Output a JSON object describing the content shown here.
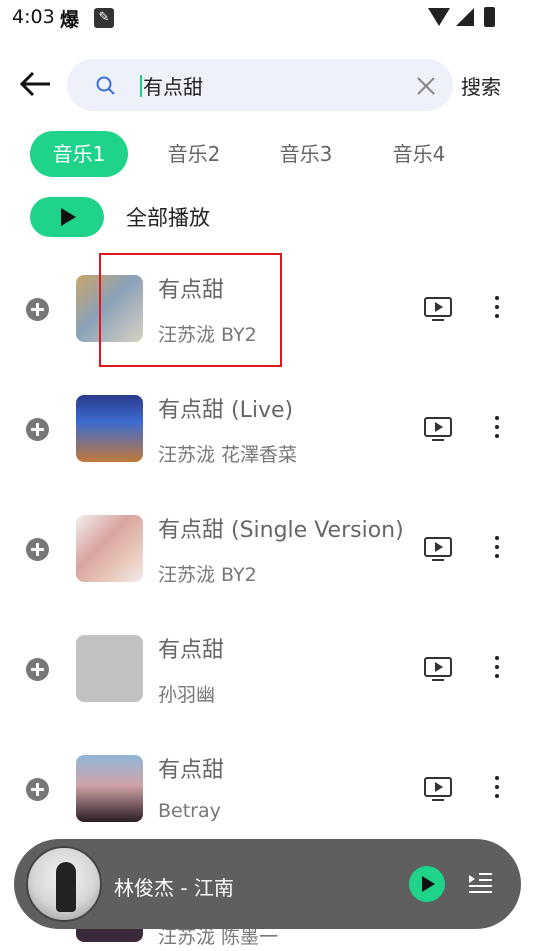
{
  "status_bar": {
    "time": "4:03",
    "extra": "爆"
  },
  "search": {
    "query": "有点甜",
    "submit_label": "搜索"
  },
  "tabs": [
    {
      "label": "音乐1",
      "active": true
    },
    {
      "label": "音乐2",
      "active": false
    },
    {
      "label": "音乐3",
      "active": false
    },
    {
      "label": "音乐4",
      "active": false
    }
  ],
  "play_all": {
    "label": "全部播放"
  },
  "songs": [
    {
      "title": "有点甜",
      "artist": "汪苏泷 BY2"
    },
    {
      "title": "有点甜 (Live)",
      "artist": "汪苏泷 花澤香菜"
    },
    {
      "title": "有点甜 (Single Version)",
      "artist": "汪苏泷 BY2"
    },
    {
      "title": "有点甜",
      "artist": "孙羽幽"
    },
    {
      "title": "有点甜",
      "artist": "Betray"
    },
    {
      "title": "",
      "artist": "汪苏泷 陈墨一"
    }
  ],
  "mini_player": {
    "now_playing": "林俊杰 - 江南"
  },
  "colors": {
    "accent": "#1fd38a",
    "selection": "#e0161f",
    "player_bg": "#5f5f5f"
  }
}
